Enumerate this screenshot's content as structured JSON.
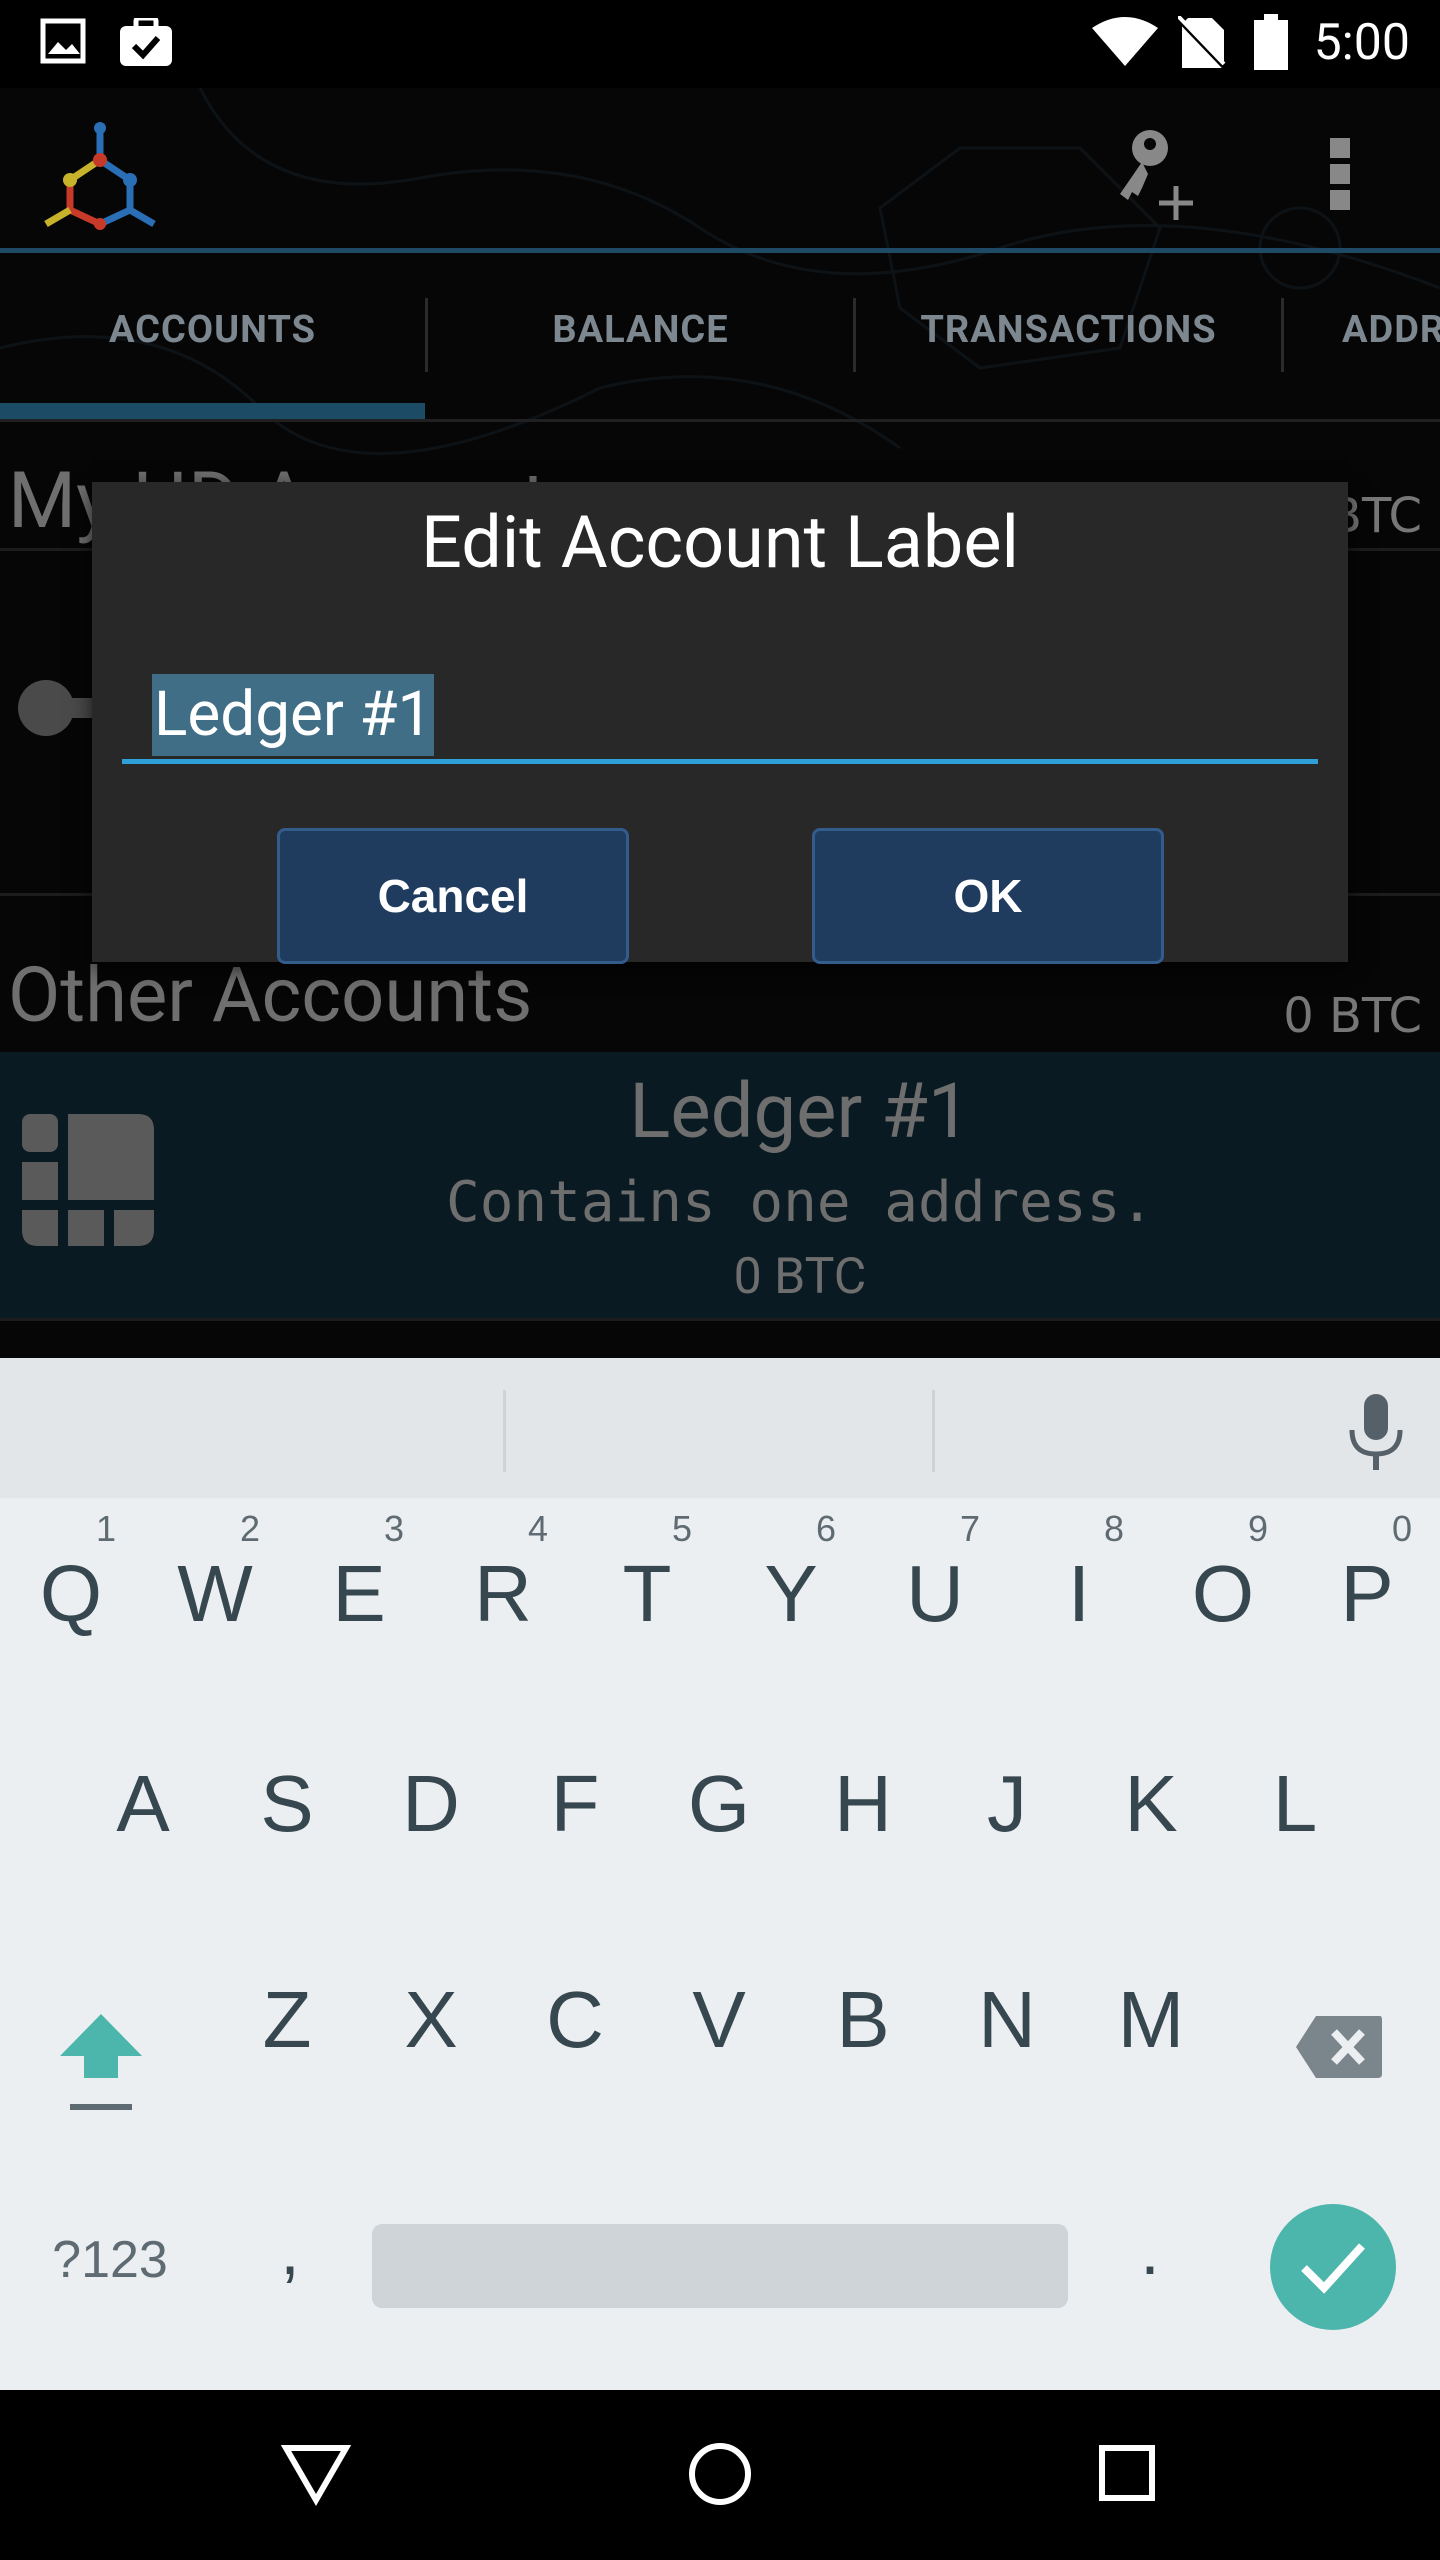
{
  "status_bar": {
    "time": "5:00",
    "icons": [
      "image-icon",
      "clipboard-check-icon",
      "wifi-icon",
      "no-sim-icon",
      "battery-icon"
    ]
  },
  "action_bar": {
    "icons": [
      "app-logo-icon",
      "add-key-icon",
      "overflow-menu-icon"
    ]
  },
  "tabs": [
    {
      "label": "ACCOUNTS"
    },
    {
      "label": "BALANCE"
    },
    {
      "label": "TRANSACTIONS"
    },
    {
      "label": "ADDR"
    }
  ],
  "background_list": {
    "hd_section_title_partial": "My HD Account",
    "hd_section_btc_partial": "BTC",
    "other_section_title": "Other Accounts",
    "other_section_btc": "0 BTC",
    "ledger_account": {
      "name": "Ledger #1",
      "description": "Contains one address.",
      "balance": "0 BTC"
    }
  },
  "dialog": {
    "title": "Edit Account Label",
    "input_value": "Ledger #1",
    "cancel_label": "Cancel",
    "ok_label": "OK"
  },
  "keyboard": {
    "row1": [
      "Q",
      "W",
      "E",
      "R",
      "T",
      "Y",
      "U",
      "I",
      "O",
      "P"
    ],
    "row1_hints": [
      "1",
      "2",
      "3",
      "4",
      "5",
      "6",
      "7",
      "8",
      "9",
      "0"
    ],
    "row2": [
      "A",
      "S",
      "D",
      "F",
      "G",
      "H",
      "J",
      "K",
      "L"
    ],
    "row3": [
      "Z",
      "X",
      "C",
      "V",
      "B",
      "N",
      "M"
    ],
    "symbols_label": "?123",
    "comma_label": ",",
    "period_label": ".",
    "accent_color": "#4db6ac"
  },
  "colors": {
    "dialog_bg": "#282828",
    "button_bg": "#1f3b5d",
    "input_underline": "#2f9fd7",
    "tab_indicator": "#1c4b66"
  }
}
